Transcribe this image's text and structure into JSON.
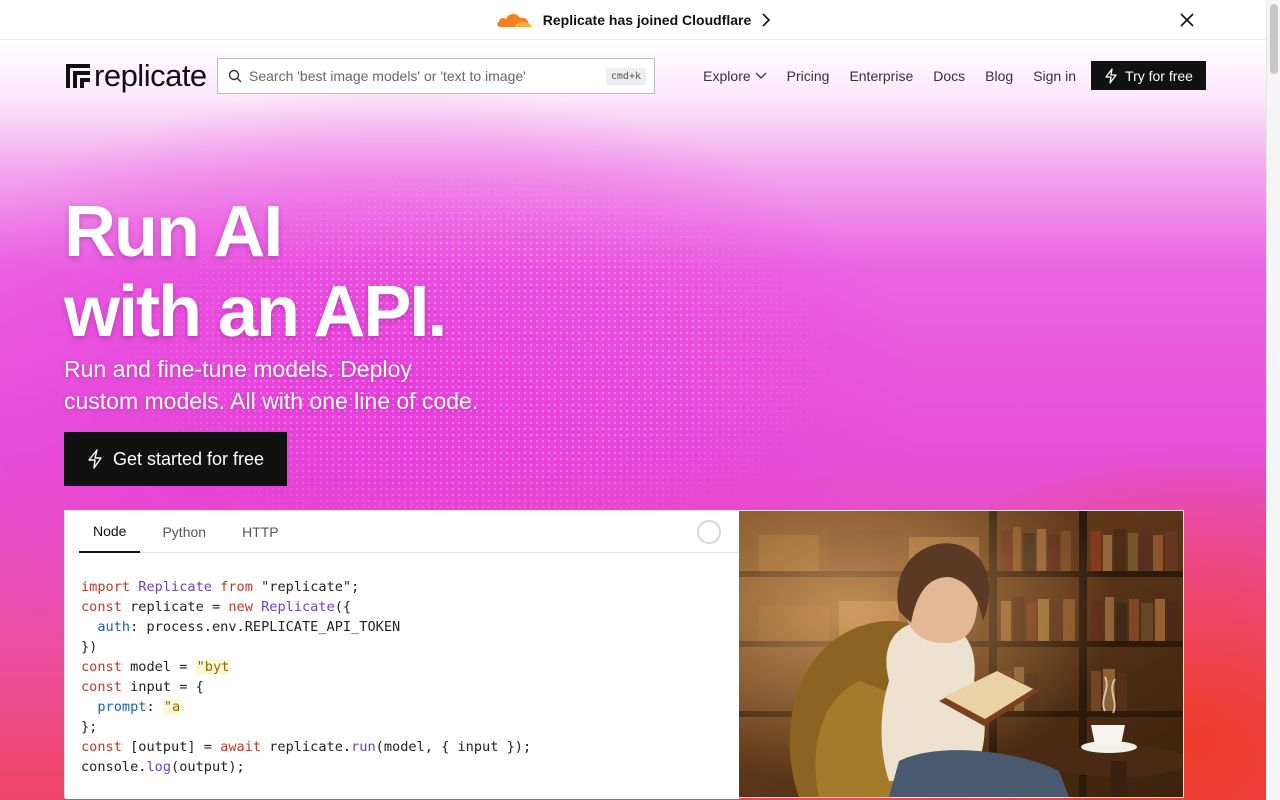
{
  "announcement": {
    "text": "Replicate has joined Cloudflare"
  },
  "nav": {
    "logo_text": "replicate",
    "search_placeholder": "Search 'best image models' or 'text to image'",
    "search_shortcut": "cmd+k",
    "links": [
      {
        "label": "Explore"
      },
      {
        "label": "Pricing"
      },
      {
        "label": "Enterprise"
      },
      {
        "label": "Docs"
      },
      {
        "label": "Blog"
      },
      {
        "label": "Sign in"
      }
    ],
    "try_label": "Try for free"
  },
  "hero": {
    "title_line1": "Run AI",
    "title_line2": "with an API.",
    "subtitle_line1": "Run and fine-tune models. Deploy",
    "subtitle_line2": "custom models. All with one line of code.",
    "cta_label": "Get started for free"
  },
  "code": {
    "tabs": [
      {
        "label": "Node",
        "active": true
      },
      {
        "label": "Python"
      },
      {
        "label": "HTTP"
      }
    ],
    "lines": {
      "l1_kw": "import",
      "l1_cls": "Replicate",
      "l1_from": "from",
      "l1_str": "\"replicate\";",
      "l2_kw": "const",
      "l2_var": "replicate =",
      "l2_new": "new",
      "l2_cls": "Replicate",
      "l2_end": "({",
      "l3_prop": "auth",
      "l3_rest": ": process.env.REPLICATE_API_TOKEN",
      "l4": "})",
      "l5_kw": "const",
      "l5_var": "model =",
      "l5_str": "\"byt",
      "l6_kw": "const",
      "l6_var": "input = {",
      "l7_prop": "prompt",
      "l7_colon": ":",
      "l7_str": "\"a",
      "l8": "};",
      "l9_kw": "const",
      "l9_var": "[output] =",
      "l9_await": "await",
      "l9_obj": "replicate.",
      "l9_fn": "run",
      "l9_end": "(model, { input });",
      "l10_obj": "console.",
      "l10_fn": "log",
      "l10_end": "(output);"
    }
  },
  "colors": {
    "accent_dark": "#111111",
    "hero_magenta": "#e54fd7",
    "hero_red": "#ee4563",
    "cloudflare_orange": "#f38020"
  }
}
